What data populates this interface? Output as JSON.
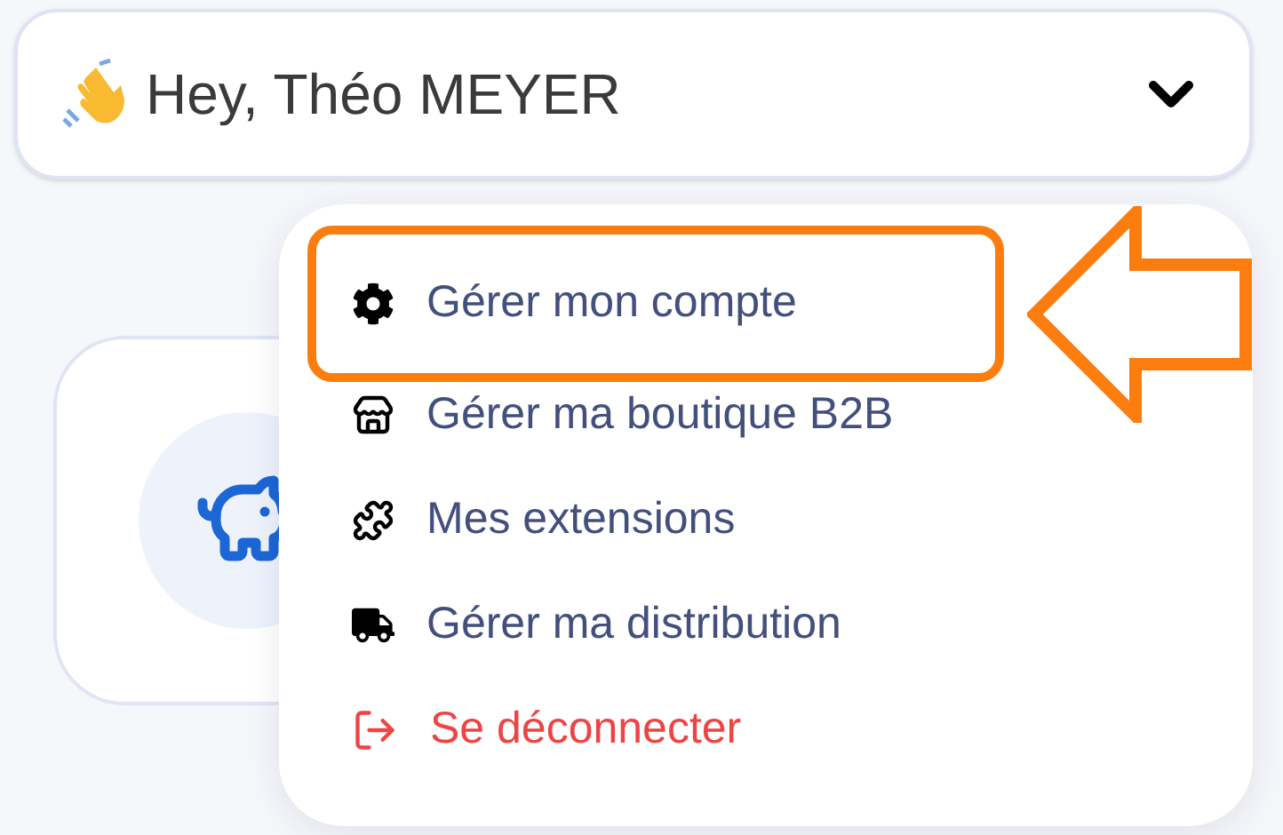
{
  "header": {
    "greeting": "Hey, Théo MEYER",
    "expanded": true
  },
  "card": {
    "kind": "savings"
  },
  "menu": {
    "items": [
      {
        "label": "Gérer mon compte",
        "kind": "account",
        "highlighted": true
      },
      {
        "label": "Gérer ma boutique B2B",
        "kind": "shop",
        "highlighted": false
      },
      {
        "label": "Mes extensions",
        "kind": "extensions",
        "highlighted": false
      },
      {
        "label": "Gérer ma distribution",
        "kind": "distribution",
        "highlighted": false
      },
      {
        "label": "Se déconnecter",
        "kind": "logout",
        "highlighted": false
      }
    ]
  }
}
